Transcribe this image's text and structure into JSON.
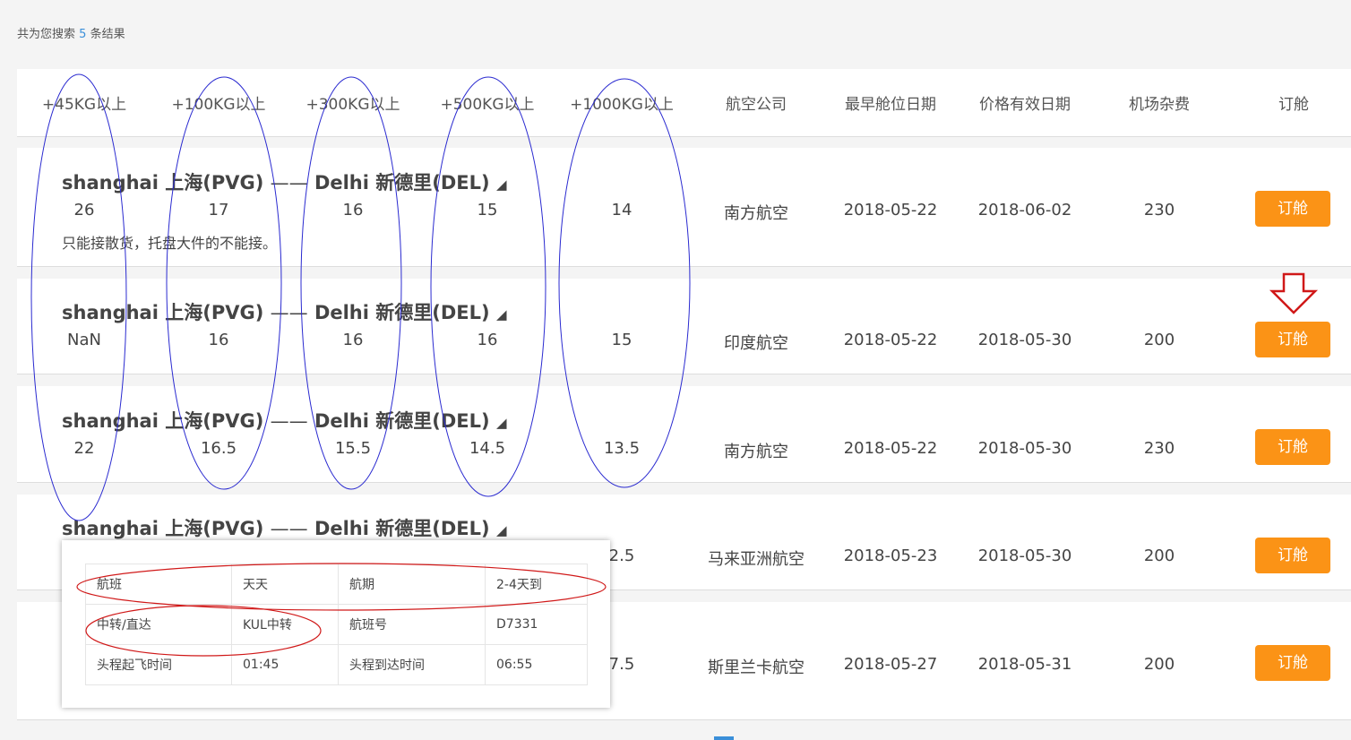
{
  "summary": {
    "prefix": "共为您搜索",
    "count": "5",
    "suffix": "条结果"
  },
  "columns": [
    "+45KG以上",
    "+100KG以上",
    "+300KG以上",
    "+500KG以上",
    "+1000KG以上",
    "航空公司",
    "最早舱位日期",
    "价格有效日期",
    "机场杂费",
    "订舱"
  ],
  "rows": [
    {
      "origin": "shanghai 上海(PVG)",
      "sep": "——",
      "dest": "Delhi 新德里(DEL)",
      "tri": "◢",
      "p45": "26",
      "p100": "17",
      "p300": "16",
      "p500": "15",
      "p1000": "14",
      "airline": "南方航空",
      "earliest": "2018-05-22",
      "valid": "2018-06-02",
      "fee": "230",
      "book": "订舱",
      "note": "只能接散货，托盘大件的不能接。"
    },
    {
      "origin": "shanghai 上海(PVG)",
      "sep": "——",
      "dest": "Delhi 新德里(DEL)",
      "tri": "◢",
      "p45": "NaN",
      "p100": "16",
      "p300": "16",
      "p500": "16",
      "p1000": "15",
      "airline": "印度航空",
      "earliest": "2018-05-22",
      "valid": "2018-05-30",
      "fee": "200",
      "book": "订舱"
    },
    {
      "origin": "shanghai 上海(PVG)",
      "sep": "——",
      "dest": "Delhi 新德里(DEL)",
      "tri": "◢",
      "p45": "22",
      "p100": "16.5",
      "p300": "15.5",
      "p500": "14.5",
      "p1000": "13.5",
      "airline": "南方航空",
      "earliest": "2018-05-22",
      "valid": "2018-05-30",
      "fee": "230",
      "book": "订舱"
    },
    {
      "origin": "shanghai 上海(PVG)",
      "sep": "——",
      "dest": "Delhi 新德里(DEL)",
      "tri": "◢",
      "p1000": "2.5",
      "airline": "马来亚洲航空",
      "earliest": "2018-05-23",
      "valid": "2018-05-30",
      "fee": "200",
      "book": "订舱"
    },
    {
      "p1000": "7.5",
      "airline": "斯里兰卡航空",
      "earliest": "2018-05-27",
      "valid": "2018-05-31",
      "fee": "200",
      "book": "订舱"
    }
  ],
  "popup": [
    [
      "航班",
      "天天",
      "航期",
      "2-4天到"
    ],
    [
      "中转/直达",
      "KUL中转",
      "航班号",
      "D7331"
    ],
    [
      "头程起飞时间",
      "01:45",
      "头程到达时间",
      "06:55"
    ]
  ],
  "colors": {
    "accent": "#fb9316",
    "link": "#3a8fd9",
    "annotation_blue": "#2a2ad0",
    "annotation_red": "#d01818"
  },
  "icons": {
    "annotation_arrow": "down-arrow-icon"
  }
}
